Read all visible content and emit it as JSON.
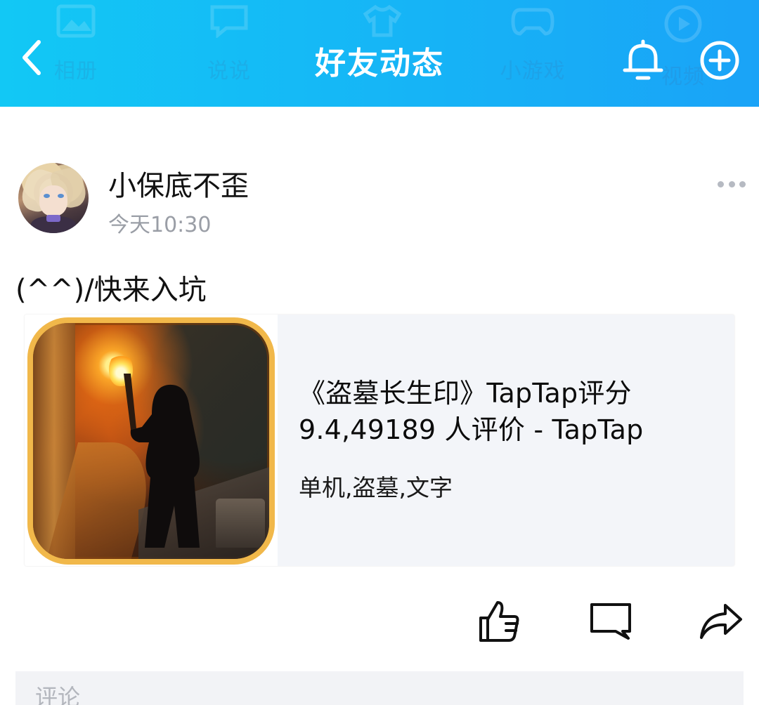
{
  "header": {
    "title": "好友动态",
    "back_icon": "chevron-left-icon",
    "bell_icon": "bell-icon",
    "add_icon": "plus-circle-icon",
    "background_colors": [
      "#12c8f5",
      "#1aa3f7"
    ],
    "ghost_nav": [
      {
        "label": "相册",
        "icon": "photo-icon"
      },
      {
        "label": "说说",
        "icon": "chat-icon"
      },
      {
        "label": "",
        "icon": "shirt-icon"
      },
      {
        "label": "小游戏",
        "icon": "gamepad-icon"
      },
      {
        "label": "视频",
        "icon": "play-icon"
      }
    ]
  },
  "post": {
    "username": "小保底不歪",
    "time": "今天10:30",
    "text": "(^^)/快来入坑",
    "more_icon": "more-dots-icon",
    "link_card": {
      "title": "《盗墓长生印》TapTap评分9.4,49189 人评价 - TapTap",
      "tags": "单机,盗墓,文字",
      "thumbnail": "game-icon"
    },
    "actions": {
      "like_icon": "thumbs-up-icon",
      "comment_icon": "comment-icon",
      "share_icon": "share-icon"
    }
  },
  "comment_box": {
    "placeholder": "评论"
  },
  "colors": {
    "muted_text": "#9a9ea6",
    "card_background": "#f3f5f9",
    "input_background": "#f2f3f6"
  }
}
